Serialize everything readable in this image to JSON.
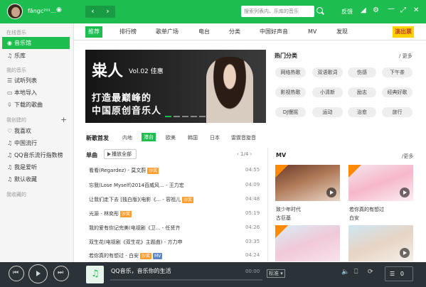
{
  "header": {
    "username": "fāngc²⁰¹...",
    "search_placeholder": "搜索列表内、乐库的音乐",
    "back": "‹",
    "forward": "›",
    "feedback": "反馈",
    "icons": [
      "shirt-icon",
      "gear-icon",
      "minimize-icon",
      "shrink-icon",
      "close-icon"
    ]
  },
  "sidebar": {
    "online_head": "在线音乐",
    "online": [
      {
        "label": "音乐馆",
        "icon": "music-hall-icon",
        "glyph": "◉",
        "active": true
      },
      {
        "label": "乐库",
        "icon": "library-icon",
        "glyph": "♫"
      }
    ],
    "mine_head": "我的音乐",
    "mine": [
      {
        "label": "试听列表",
        "icon": "list-icon",
        "glyph": "☰"
      },
      {
        "label": "本地导入",
        "icon": "computer-icon",
        "glyph": "▭"
      },
      {
        "label": "下载的歌曲",
        "icon": "download-icon",
        "glyph": "⇩"
      }
    ],
    "created_head": "我创建的",
    "created": [
      {
        "label": "我喜欢",
        "icon": "heart-icon",
        "glyph": "♡"
      },
      {
        "label": "中国流行",
        "icon": "playlist-icon",
        "glyph": "♫"
      },
      {
        "label": "QQ音乐流行指数榜",
        "icon": "playlist-icon",
        "glyph": "♫"
      },
      {
        "label": "我是爱听",
        "icon": "playlist-icon",
        "glyph": "♫"
      },
      {
        "label": "默认收藏",
        "icon": "playlist-icon",
        "glyph": "♫"
      }
    ],
    "fav_head": "我收藏的",
    "plus": "+"
  },
  "tabs": [
    "推荐",
    "排行榜",
    "歌单广场",
    "电台",
    "分类",
    "中国好声音",
    "MV",
    "发现"
  ],
  "tab_badge": "演出票",
  "banner": {
    "logo": "粜人",
    "vol": "Vol.02 佳惠",
    "line1": "打造最巅峰的",
    "line2": "中国原创音乐人"
  },
  "categories": {
    "title": "热门分类",
    "more": "/ 更多",
    "tags": [
      "网络热歌",
      "双语歌词",
      "伤感",
      "下午茶",
      "影视热歌",
      "小清新",
      "励志",
      "经典好歌",
      "DJ慢摇",
      "运动",
      "治愈",
      "旅行"
    ]
  },
  "new_songs": {
    "title": "新歌首发",
    "filters": [
      "内地",
      "港台",
      "欧美",
      "韩国",
      "日本",
      "雷霆音旋音"
    ],
    "active_filter": "港台"
  },
  "singles": {
    "title": "单曲",
    "play_all": "播放全部",
    "page": "1/4",
    "songs": [
      {
        "title": "看看(Regardez) - 莫文蔚",
        "badge": "沙奖",
        "badge_type": "hq",
        "duration": "04:55"
      },
      {
        "title": "忘我(Lose Myself)2014百威风...  - 王力宏",
        "badge": "",
        "badge_type": "",
        "duration": "04:09"
      },
      {
        "title": "让我们走下去 [独白版](电影《...  - 容祖儿",
        "badge": "沙奖",
        "badge_type": "hq",
        "duration": "04:48"
      },
      {
        "title": "光源 - 林奕彤",
        "badge": "沙奖",
        "badge_type": "hq",
        "duration": "05:19"
      },
      {
        "title": "我的爱有你记完美(电视剧《卫... - 任贤齐",
        "badge": "",
        "badge_type": "",
        "duration": "04:26"
      },
      {
        "title": "双生花(电视剧《双生花》主题曲) - 方力申",
        "badge": "",
        "badge_type": "",
        "duration": "03:35"
      },
      {
        "title": "若你真的有想过 - 白安",
        "badge": "沙奖",
        "badge_type": "hq",
        "badge2": "MV",
        "duration": "04:24"
      }
    ]
  },
  "mv": {
    "title": "MV",
    "more": "/更多",
    "items": [
      {
        "title": "致少年时代",
        "artist": "古巨基"
      },
      {
        "title": "若你真的有想过",
        "artist": "白安"
      }
    ]
  },
  "player": {
    "title": "QQ音乐，音乐你的生活",
    "time": "00:00",
    "quality": "标准",
    "count": "0",
    "progress": 0
  }
}
